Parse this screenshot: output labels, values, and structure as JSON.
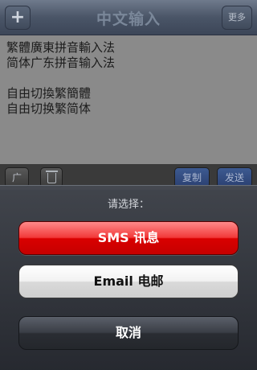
{
  "navbar": {
    "title": "中文输入",
    "add_label": "+",
    "more_label": "更多"
  },
  "text_area": {
    "lines": [
      "繁體廣東拼音輸入法",
      "简体广东拼音输入法",
      "",
      "自由切換繁簡體",
      "自由切换繁简体"
    ]
  },
  "toolbar": {
    "canton_label": "广",
    "trash_icon": "trash-icon",
    "copy_label": "复制",
    "send_label": "发送"
  },
  "action_sheet": {
    "title": "请选择：",
    "sms_label": "SMS 讯息",
    "email_label": "Email 电邮",
    "cancel_label": "取消"
  },
  "colors": {
    "sms_button": "#e01010",
    "email_button": "#f0f0f0",
    "cancel_button": "#3a3e46",
    "navbar": "#4a5567"
  }
}
